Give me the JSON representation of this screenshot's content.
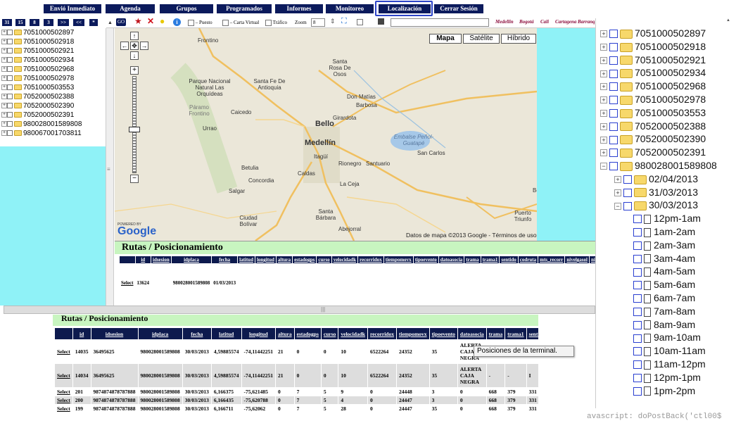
{
  "nav": {
    "items": [
      "Envió Inmediato",
      "Agenda",
      "Grupos",
      "Programados",
      "Informes",
      "Monitoreo",
      "Localización",
      "Cerrar Sesión"
    ],
    "active": "Localización"
  },
  "toolbar": {
    "left_buttons": [
      "31",
      "15",
      "8",
      "3",
      ">>",
      "<<",
      "*"
    ],
    "map_prefix": "GO",
    "puesto": "Puesto",
    "carta_virtual": "Carta Virtual",
    "trafico": "Tráfico",
    "zoom_label": "Zoom",
    "zoom_value": "8",
    "cities": [
      "Medellin",
      "Bogotá",
      "Cali",
      "Cartagena",
      "Barranquilla"
    ]
  },
  "left_tree": [
    "7051000502897",
    "7051000502918",
    "7051000502921",
    "7051000502934",
    "7051000502968",
    "7051000502978",
    "7051000503553",
    "7052000502388",
    "7052000502390",
    "7052000502391",
    "980028001589808",
    "980067001703811"
  ],
  "map": {
    "types": [
      "Mapa",
      "Satélite",
      "Híbrido"
    ],
    "active": "Mapa",
    "powered": "POWERED BY",
    "logo": "Google",
    "attribution": "Datos de mapa ©2013 Google - Términos de uso",
    "labels": [
      "Frontino",
      "Santa Rosa De Osos",
      "Parque Nacional Natural Las Orquídeas",
      "Santa Fe De Antioquia",
      "Don Matías",
      "Barbosa",
      "Páramo Frontino",
      "Caicedo",
      "Girardota",
      "Urrao",
      "Bello",
      "Medellín",
      "Embalse Peñol-Guatapé",
      "Itagüí",
      "San Carlos",
      "Rionegro",
      "Santuario",
      "Betulia",
      "Caldas",
      "Concordia",
      "La Ceja",
      "Salgar",
      "Ciudad Bolívar",
      "Santa Bárbara",
      "Abejorral",
      "Puerto Triunfo",
      "Bo"
    ]
  },
  "rutas": {
    "title": "Rutas / Posicionamiento",
    "headers": [
      "",
      "id",
      "idsesion",
      "idplaca",
      "fecha",
      "latitud",
      "longitud",
      "altura",
      "estadogps",
      "curso",
      "velocidadk",
      "recorridox",
      "tiempomovx",
      "tipoevento",
      "datoasocia",
      "trama",
      "trama1",
      "sentido",
      "codruta",
      "mts_recorr",
      "nivelgasol",
      "nivelacei"
    ],
    "row": [
      "Select",
      "13624",
      "",
      "980028001589808",
      "01/03/2013",
      "",
      "",
      "",
      "",
      "",
      "",
      "",
      "",
      "",
      "",
      "",
      "",
      "",
      "",
      "",
      "",
      ""
    ]
  },
  "lower": {
    "title": "Rutas / Posicionamiento",
    "headers": [
      "",
      "id",
      "idsesion",
      "idplaca",
      "fecha",
      "latitud",
      "longitud",
      "altura",
      "estadogps",
      "curso",
      "velocidadk",
      "recorridox",
      "tiempomovx",
      "tipoevento",
      "datoasocia",
      "trama",
      "trama1",
      "senti"
    ],
    "rows": [
      [
        "Select",
        "14035",
        "36495625",
        "980028001589808",
        "30/03/2013",
        "4,59885574",
        "-74,11442251",
        "21",
        "0",
        "0",
        "10",
        "6522264",
        "24352",
        "35",
        "ALERTA CAJA NEGRA",
        "",
        "",
        ""
      ],
      [
        "Select",
        "14034",
        "36495625",
        "980028001589808",
        "30/03/2013",
        "4,59885574",
        "-74,11442251",
        "21",
        "0",
        "0",
        "10",
        "6522264",
        "24352",
        "35",
        "ALERTA CAJA NEGRA",
        "-",
        "-",
        "I"
      ],
      [
        "Select",
        "201",
        "9874874878787888",
        "980028001589808",
        "30/03/2013",
        "6,166375",
        "-75,621485",
        "0",
        "7",
        "5",
        "9",
        "0",
        "24448",
        "3",
        "0",
        "668",
        "379",
        "331"
      ],
      [
        "Select",
        "200",
        "9874874878787888",
        "980028001589808",
        "30/03/2013",
        "6,166435",
        "-75,620788",
        "0",
        "7",
        "5",
        "4",
        "0",
        "24447",
        "3",
        "0",
        "668",
        "379",
        "331"
      ],
      [
        "Select",
        "199",
        "9874874878787888",
        "980028001589808",
        "30/03/2013",
        "6,166711",
        "-75,62062",
        "0",
        "7",
        "5",
        "28",
        "0",
        "24447",
        "35",
        "0",
        "668",
        "379",
        "331"
      ]
    ]
  },
  "tooltip": "Posiciones de la terminal.",
  "right_tree": {
    "devices": [
      "7051000502897",
      "7051000502918",
      "7051000502921",
      "7051000502934",
      "7051000502968",
      "7051000502978",
      "7051000503553",
      "7052000502388",
      "7052000502390",
      "7052000502391",
      "980028001589808"
    ],
    "dates": [
      "02/04/2013",
      "31/03/2013",
      "30/03/2013"
    ],
    "hours": [
      "12pm-1am",
      "1am-2am",
      "2am-3am",
      "3am-4am",
      "4am-5am",
      "5am-6am",
      "6am-7am",
      "7am-8am",
      "8am-9am",
      "9am-10am",
      "10am-11am",
      "11am-12pm",
      "12pm-1pm",
      "1pm-2pm"
    ]
  },
  "status_bar": "avascript: doPostBack('ctl00$"
}
